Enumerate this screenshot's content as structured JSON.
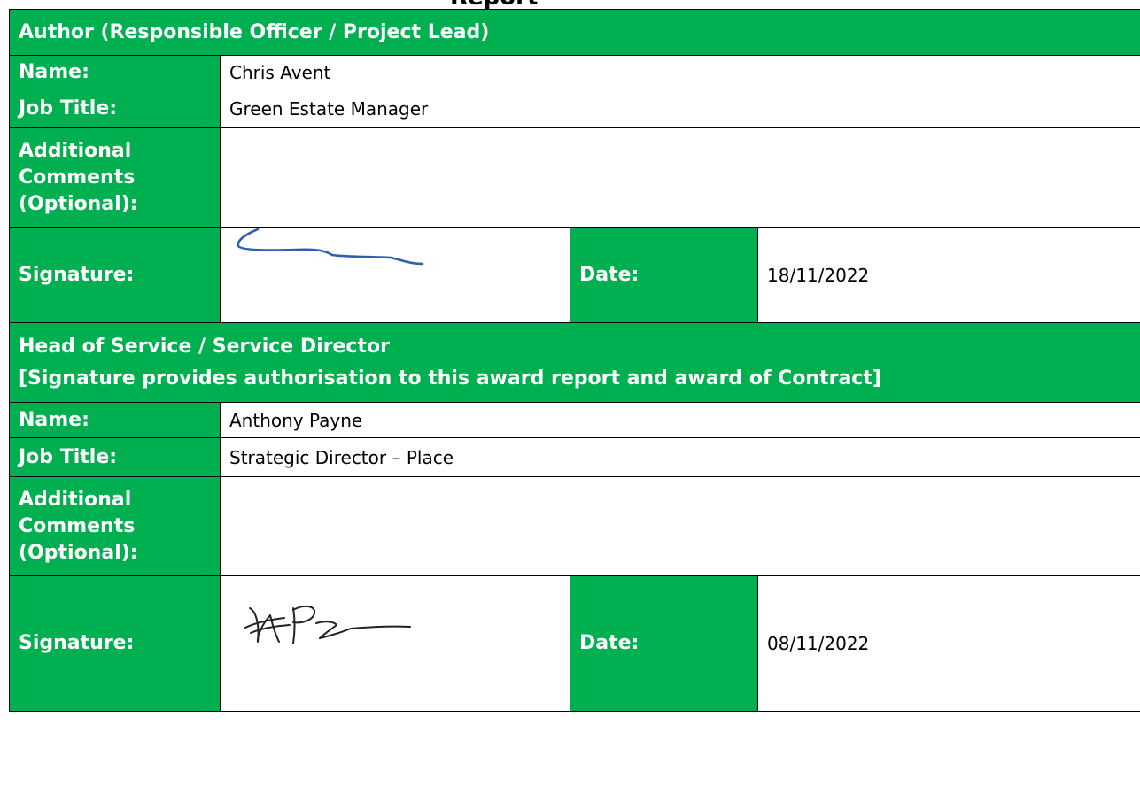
{
  "top_heading": "Report",
  "author": {
    "section_title": "Author (Responsible Officer / Project Lead)",
    "name_label": "Name:",
    "name_value": "Chris Avent",
    "job_title_label": "Job Title:",
    "job_title_value": "Green Estate Manager",
    "comments_label_lines": [
      "Additional",
      "Comments",
      "(Optional):"
    ],
    "comments_value": "",
    "signature_label": "Signature:",
    "date_label": "Date:",
    "date_value": "18/11/2022"
  },
  "head_of_service": {
    "section_title": "Head of Service / Service Director",
    "section_subtitle": "[Signature provides authorisation to this award report and award of Contract]",
    "name_label": "Name:",
    "name_value": "Anthony Payne",
    "job_title_label": "Job Title:",
    "job_title_value": "Strategic Director – Place",
    "comments_label_lines": [
      "Additional",
      "Comments",
      "(Optional):"
    ],
    "comments_value": "",
    "signature_label": "Signature:",
    "date_label": "Date:",
    "date_value": "08/11/2022"
  },
  "colors": {
    "label_bg": "#00b050",
    "label_text": "#ffffff",
    "value_bg": "#ffffff",
    "border": "#000000",
    "signature_ink_author": "#2f5fb3",
    "signature_ink_director": "#222222"
  }
}
